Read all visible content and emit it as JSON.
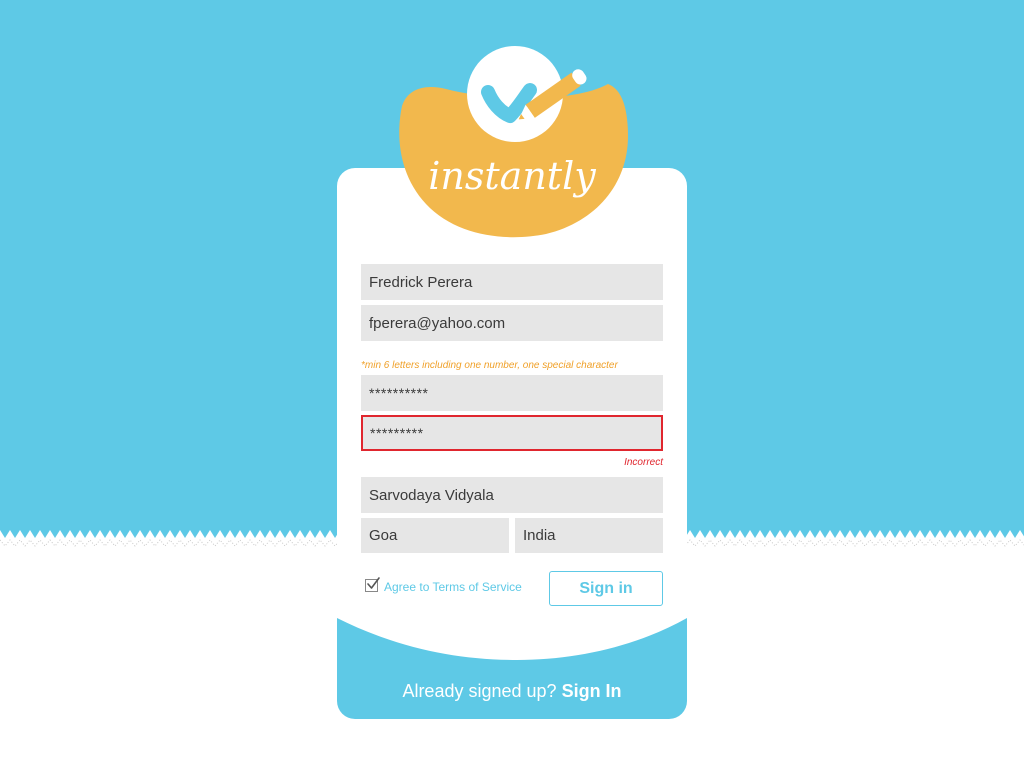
{
  "brand": {
    "logo_text": "instantly"
  },
  "colors": {
    "sky": "#5ec9e6",
    "accent": "#f2b84d",
    "error": "#e0262e",
    "field": "#e6e6e6"
  },
  "form": {
    "name_value": "Fredrick Perera",
    "email_value": "fperera@yahoo.com",
    "password_hint": "*min 6 letters including one number, one special character",
    "password_value": "**********",
    "confirm_password_value": "*********",
    "confirm_error": "Incorrect",
    "school_value": "Sarvodaya Vidyala",
    "state_value": "Goa",
    "country_value": "India",
    "agree_checked": true,
    "agree_label": "Agree to Terms of Service",
    "submit_label": "Sign in"
  },
  "footer": {
    "prompt": "Already signed up?",
    "link_label": "Sign In"
  }
}
